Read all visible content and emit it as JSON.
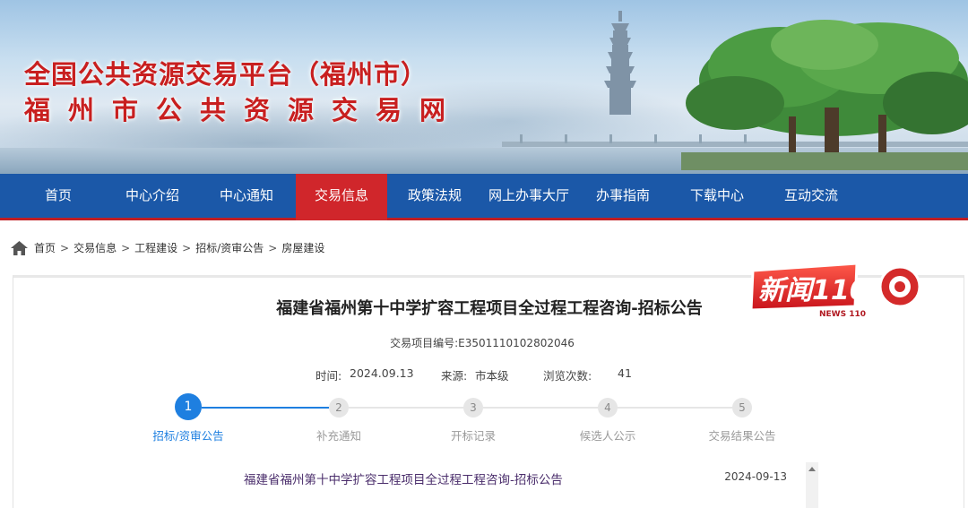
{
  "banner": {
    "title": "全国公共资源交易平台（福州市）",
    "subtitle": "福州市公共资源交易网"
  },
  "nav": {
    "items": [
      {
        "label": "首页"
      },
      {
        "label": "中心介绍"
      },
      {
        "label": "中心通知"
      },
      {
        "label": "交易信息",
        "active": true
      },
      {
        "label": "政策法规"
      },
      {
        "label": "网上办事大厅"
      },
      {
        "label": "办事指南"
      },
      {
        "label": "下载中心"
      },
      {
        "label": "互动交流"
      }
    ]
  },
  "breadcrumb": {
    "items": [
      "首页",
      "交易信息",
      "工程建设",
      "招标/资审公告",
      "房屋建设"
    ],
    "separator": ">"
  },
  "article": {
    "title": "福建省福州第十中学扩容工程项目全过程工程咨询-招标公告",
    "project_code_label": "交易项目编号:E3501110102802046",
    "time_label": "时间:",
    "time_value": "2024.09.13",
    "source_label": "来源:",
    "source_value": "市本级",
    "views_label": "浏览次数:",
    "views_value": "41"
  },
  "stepper": {
    "steps": [
      {
        "number": "1",
        "label": "招标/资审公告",
        "active": true
      },
      {
        "number": "2",
        "label": "补充通知"
      },
      {
        "number": "3",
        "label": "开标记录"
      },
      {
        "number": "4",
        "label": "候选人公示"
      },
      {
        "number": "5",
        "label": "交易结果公告"
      }
    ]
  },
  "list": {
    "items": [
      {
        "title": "福建省福州第十中学扩容工程项目全过程工程咨询-招标公告",
        "date": "2024-09-13"
      }
    ]
  },
  "watermark": {
    "text": "新闻110",
    "sub": "NEWS 110"
  },
  "colors": {
    "nav_bg": "#1b58a8",
    "nav_active": "#d0262b",
    "banner_title": "#c81f1f",
    "step_active": "#1e7fe0"
  }
}
